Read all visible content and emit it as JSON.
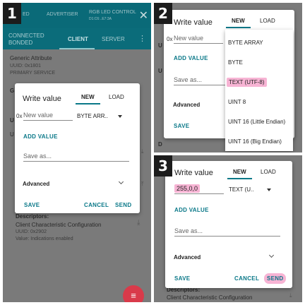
{
  "panel1": {
    "badge": "1",
    "appbar": {
      "left": "ED",
      "center": "ADVERTISER",
      "title": "RGB LED CONTROL",
      "addr": "D1:C6:..E7:3A"
    },
    "status": {
      "line1": "CONNECTED",
      "line2": "BONDED"
    },
    "tabs": {
      "client": "CLIENT",
      "server": "SERVER"
    },
    "service": {
      "name": "Generic Attribute",
      "uuid_label": "UUID:",
      "uuid": "0x1801",
      "type": "PRIMARY SERVICE"
    },
    "bg_fragments": {
      "g": "G",
      "u": "U",
      "u2": "U"
    },
    "descriptor": {
      "header": "Descriptors:",
      "name": "Client Characteristic Configuration",
      "uuid_label": "UUID:",
      "uuid": "0x2902",
      "value": "Value: Indications enabled"
    },
    "dialog": {
      "title": "Write value",
      "tab_new": "NEW",
      "tab_load": "LOAD",
      "prefix": "0x",
      "input_placeholder": "New value",
      "type": "BYTE ARR..",
      "add_value": "ADD VALUE",
      "save_as": "Save as...",
      "advanced": "Advanced",
      "save": "SAVE",
      "cancel": "CANCEL",
      "send": "SEND"
    },
    "fab_icon": "list-icon"
  },
  "panel2": {
    "badge": "2",
    "dialog": {
      "title": "Write value",
      "tab_new": "NEW",
      "tab_load": "LOAD",
      "prefix": "0x",
      "input_placeholder": "New value",
      "add_value": "ADD VALUE",
      "save_as": "Save as...",
      "advanced": "Advanced",
      "save": "SAVE"
    },
    "bg_fragments": {
      "u1": "U",
      "u2": "U",
      "d": "D"
    },
    "menu": [
      "BYTE ARRAY",
      "BYTE",
      "TEXT (UTF-8)",
      "UINT 8",
      "UINT 16 (Little Endian)",
      "UINT 16 (Big Endian)"
    ],
    "highlight_color": "#f7b4d4"
  },
  "panel3": {
    "badge": "3",
    "dialog": {
      "title": "Write value",
      "tab_new": "NEW",
      "tab_load": "LOAD",
      "input_value": "255,0,0",
      "type": "TEXT (U..",
      "add_value": "ADD VALUE",
      "save_as": "Save as...",
      "advanced": "Advanced",
      "save": "SAVE",
      "cancel": "CANCEL",
      "send": "SEND"
    },
    "descriptor": {
      "header": "Descriptors:",
      "name": "Client Characteristic Configuration"
    }
  },
  "colors": {
    "accent": "#0a7888",
    "appbar": "#0a6a78",
    "highlight": "#f7b4d4",
    "fab": "#d93a4a"
  }
}
